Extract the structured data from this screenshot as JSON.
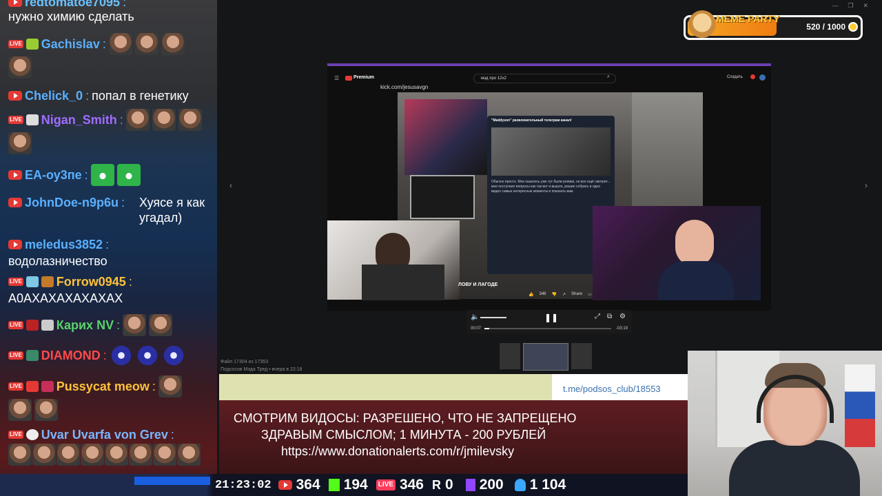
{
  "chat": [
    {
      "user": "redtomatoe7095",
      "text": "нужно химию сделать",
      "color": "#69c2ff"
    },
    {
      "user": "Gachislav",
      "text": "",
      "color": "#5ab0ff"
    },
    {
      "user": "Chelick_0",
      "text": "попал в генетику",
      "color": "#5ab0ff"
    },
    {
      "user": "Nigan_Smith",
      "text": "",
      "color": "#a06cff"
    },
    {
      "user": "EA-оу3пе",
      "text": "",
      "color": "#5ab0ff"
    },
    {
      "user": "JohnDoe-n9p6u",
      "text": "Хуясе я как угадал)",
      "color": "#5ab0ff"
    },
    {
      "user": "meledus3852",
      "text": "водолазничество",
      "color": "#5ab0ff"
    },
    {
      "user": "Forrow0945",
      "text": "А0АХАХАХАХАХАХ",
      "color": "#ffc23a"
    },
    {
      "user": "Карих NV",
      "text": "",
      "color": "#58d36a"
    },
    {
      "user": "DIAMOND",
      "text": "",
      "color": "#ff4a4a"
    },
    {
      "user": "Pussycat meow",
      "text": "",
      "color": "#ffc23a"
    },
    {
      "user": "Uvar Uvarfa von Grev",
      "text": "",
      "color": "#7ab6ff"
    }
  ],
  "meme_party": {
    "title": "MEME PARTY",
    "current": "520",
    "max": "1000",
    "count": "520 / 1000",
    "progress": 0.52
  },
  "viewer": {
    "brand": "Premium",
    "search": "мэд про 12х2",
    "kick_url": "kick.com/jesusavgn",
    "create_label": "Создать",
    "channel_title": "\"Maddyson\" развлекательный телеграм канал!",
    "post_text": "Обычно просто. Мне казалось уже тут были ролики, но все ещё смотрят... мне поступают вопросы как так вот и вышло, решил собрать в одно видео самые интересные моменты и показать вам.",
    "caption": "ЛОВУ И ЛАГОДЕ",
    "likes": "348",
    "share": "Share",
    "time_current": "00:07",
    "time_total": "-03:19",
    "progress": 0.04,
    "file_counter": "Файл 17304 из 17353",
    "file_source": "Подсосов Мэда Тред • вчера в 22:18"
  },
  "link": "t.me/podsos_club/18553",
  "info_lines": [
    "СМОТРИМ ВИДОСЫ: РАЗРЕШЕНО, ЧТО НЕ ЗАПРЕЩЕНО",
    "ЗДРАВЫМ СМЫСЛОМ; 1 МИНУТА - 200 РУБЛЕЙ",
    "https://www.donationalerts.com/r/jmilevsky"
  ],
  "stats": {
    "clock": "21:23:02",
    "youtube": "364",
    "kick": "194",
    "vk_live": "346",
    "rutube": "0",
    "twitch": "200",
    "followers": "1 104",
    "colors": {
      "youtube": "#e53935",
      "kick": "#53fc18",
      "vk": "#ff3b5c",
      "twitch": "#9146ff",
      "user": "#3aa6ff"
    }
  }
}
